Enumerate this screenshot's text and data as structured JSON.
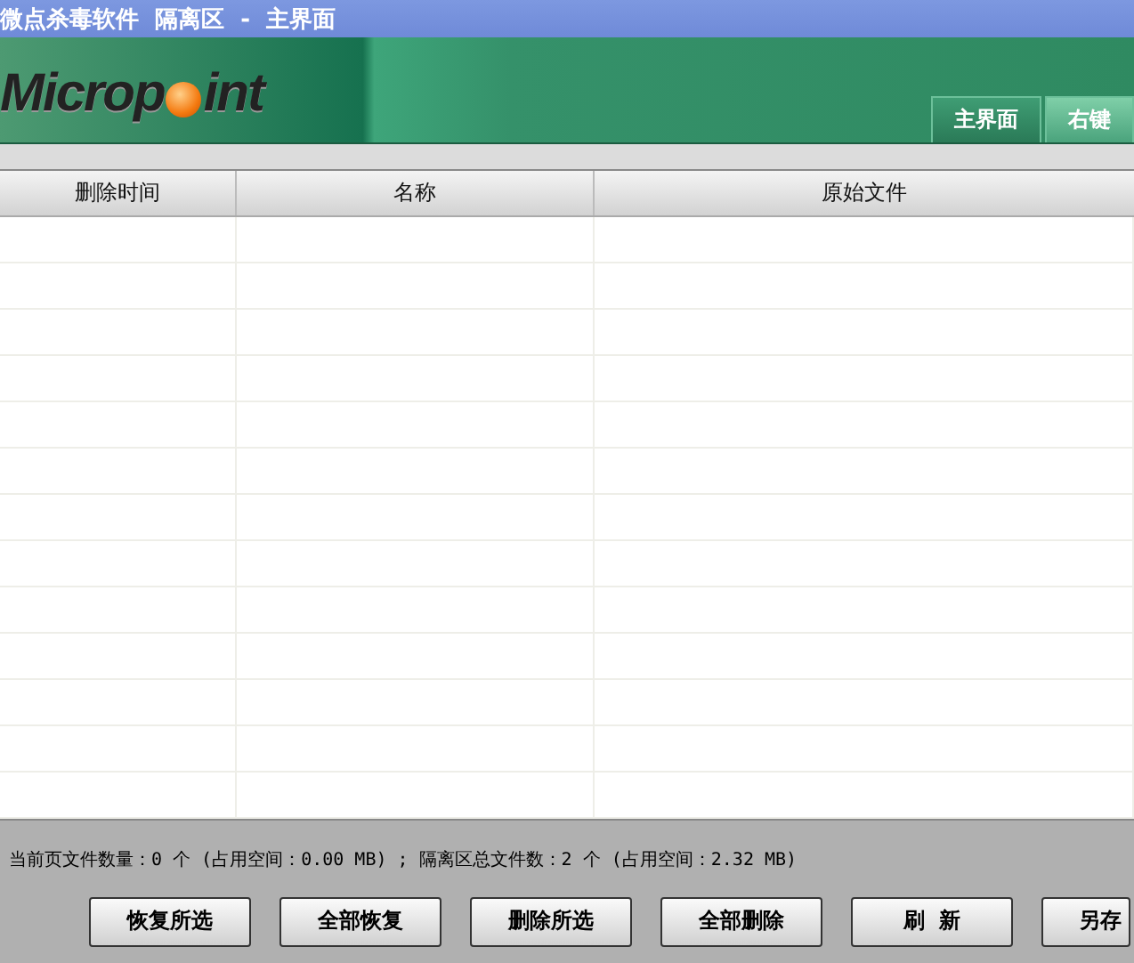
{
  "window": {
    "title": "微点杀毒软件  隔离区  -  主界面"
  },
  "logo": {
    "text_before": "Microp",
    "text_after": "int"
  },
  "tabs": [
    {
      "label": "主界面",
      "selected": false
    },
    {
      "label": "右键",
      "selected": true
    }
  ],
  "table": {
    "columns": [
      "删除时间",
      "名称",
      "原始文件"
    ]
  },
  "status_bar": {
    "summary": "当前页文件数量：0 个 (占用空间：0.00 MB) ; 隔离区总文件数：2 个 (占用空间：2.32 MB)"
  },
  "buttons": [
    "恢复所选",
    "全部恢复",
    "删除所选",
    "全部删除",
    "刷  新",
    "另存"
  ]
}
